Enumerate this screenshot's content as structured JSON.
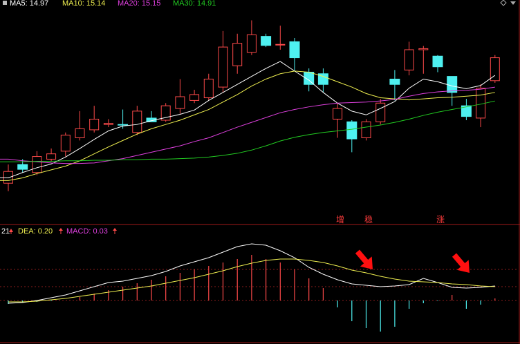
{
  "colors": {
    "up": "#ff4a4a",
    "down": "#4ef0f0",
    "ma5": "#ffffff",
    "ma10": "#f0f050",
    "ma20": "#e040e0",
    "ma30": "#22cc22",
    "dif": "#ffffff",
    "dea": "#f0f050",
    "macd_label": "#e040e0",
    "grid": "#8a1c1c",
    "arrow": "#ff1010",
    "label_text": "#ff3c3c"
  },
  "legend": {
    "ma5": "MA5: 14.97",
    "ma10": "MA10: 15.14",
    "ma20": "MA20: 15.15",
    "ma30": "MA30: 14.91"
  },
  "lower_header": {
    "dif_fragment": "21",
    "dea": "DEA: 0.20",
    "macd": "MACD: 0.03"
  },
  "annotations": [
    "增",
    "稳",
    "涨"
  ],
  "icons": [
    "arrow-up-icon",
    "diamond-icon",
    "arrow-down-icon"
  ],
  "chart_data": [
    {
      "type": "candlestick",
      "title": "",
      "series": [
        {
          "name": "K",
          "values": [
            {
              "o": 14.0,
              "h": 14.35,
              "l": 13.85,
              "c": 14.22
            },
            {
              "o": 14.35,
              "h": 14.45,
              "l": 14.2,
              "c": 14.26
            },
            {
              "o": 14.2,
              "h": 14.6,
              "l": 14.15,
              "c": 14.5
            },
            {
              "o": 14.45,
              "h": 14.65,
              "l": 14.4,
              "c": 14.55
            },
            {
              "o": 14.6,
              "h": 14.95,
              "l": 14.5,
              "c": 14.9
            },
            {
              "o": 14.85,
              "h": 15.35,
              "l": 14.8,
              "c": 15.02
            },
            {
              "o": 15.0,
              "h": 15.45,
              "l": 14.95,
              "c": 15.2
            },
            {
              "o": 15.1,
              "h": 15.2,
              "l": 15.05,
              "c": 15.12
            },
            {
              "o": 15.1,
              "h": 15.38,
              "l": 15.02,
              "c": 15.09
            },
            {
              "o": 14.95,
              "h": 15.45,
              "l": 14.9,
              "c": 15.35
            },
            {
              "o": 15.22,
              "h": 15.35,
              "l": 15.15,
              "c": 15.15
            },
            {
              "o": 15.18,
              "h": 15.5,
              "l": 15.15,
              "c": 15.45
            },
            {
              "o": 15.4,
              "h": 15.95,
              "l": 15.3,
              "c": 15.62
            },
            {
              "o": 15.55,
              "h": 15.75,
              "l": 15.5,
              "c": 15.66
            },
            {
              "o": 15.6,
              "h": 16.05,
              "l": 15.55,
              "c": 15.95
            },
            {
              "o": 15.8,
              "h": 16.85,
              "l": 15.7,
              "c": 16.55
            },
            {
              "o": 16.2,
              "h": 16.8,
              "l": 16.05,
              "c": 16.62
            },
            {
              "o": 16.45,
              "h": 17.05,
              "l": 16.4,
              "c": 16.78
            },
            {
              "o": 16.75,
              "h": 16.8,
              "l": 16.55,
              "c": 16.58
            },
            {
              "o": 16.6,
              "h": 16.95,
              "l": 16.5,
              "c": 16.6
            },
            {
              "o": 16.65,
              "h": 16.72,
              "l": 16.1,
              "c": 16.35
            },
            {
              "o": 16.08,
              "h": 16.15,
              "l": 15.72,
              "c": 15.85
            },
            {
              "o": 16.05,
              "h": 16.15,
              "l": 15.7,
              "c": 15.85
            },
            {
              "o": 15.2,
              "h": 15.5,
              "l": 14.85,
              "c": 15.4
            },
            {
              "o": 15.15,
              "h": 15.18,
              "l": 14.58,
              "c": 14.83
            },
            {
              "o": 14.85,
              "h": 15.2,
              "l": 14.8,
              "c": 15.15
            },
            {
              "o": 15.15,
              "h": 15.58,
              "l": 15.1,
              "c": 15.5
            },
            {
              "o": 15.95,
              "h": 16.12,
              "l": 15.55,
              "c": 15.85
            },
            {
              "o": 16.12,
              "h": 16.65,
              "l": 16.02,
              "c": 16.5
            },
            {
              "o": 16.5,
              "h": 16.57,
              "l": 16.05,
              "c": 16.52
            },
            {
              "o": 16.38,
              "h": 16.4,
              "l": 16.08,
              "c": 16.18
            },
            {
              "o": 16.0,
              "h": 16.0,
              "l": 15.45,
              "c": 15.7
            },
            {
              "o": 15.45,
              "h": 15.58,
              "l": 15.18,
              "c": 15.25
            },
            {
              "o": 15.22,
              "h": 15.85,
              "l": 15.05,
              "c": 15.78
            },
            {
              "o": 15.92,
              "h": 16.4,
              "l": 15.88,
              "c": 16.35
            }
          ]
        }
      ],
      "moving_averages": [
        {
          "name": "MA5",
          "values": [
            14.1,
            14.2,
            14.29,
            14.36,
            14.49,
            14.65,
            14.82,
            14.98,
            15.07,
            15.1,
            15.17,
            15.23,
            15.29,
            15.37,
            15.55,
            15.7,
            15.85,
            16.0,
            16.15,
            16.28,
            16.1,
            15.93,
            15.7,
            15.5,
            15.35,
            15.28,
            15.4,
            15.53,
            15.78,
            15.95,
            15.9,
            15.82,
            15.77,
            15.83,
            16.02
          ]
        },
        {
          "name": "MA10",
          "values": [
            14.05,
            14.1,
            14.18,
            14.25,
            14.32,
            14.42,
            14.55,
            14.68,
            14.8,
            14.92,
            15.02,
            15.1,
            15.18,
            15.28,
            15.38,
            15.52,
            15.66,
            15.82,
            15.95,
            16.05,
            16.1,
            16.08,
            16.0,
            15.9,
            15.8,
            15.68,
            15.6,
            15.58,
            15.56,
            15.58,
            15.6,
            15.61,
            15.63,
            15.65,
            15.7
          ]
        },
        {
          "name": "MA20",
          "values": [
            14.45,
            14.42,
            14.4,
            14.38,
            14.37,
            14.37,
            14.38,
            14.42,
            14.46,
            14.52,
            14.58,
            14.64,
            14.7,
            14.78,
            14.85,
            14.95,
            15.05,
            15.14,
            15.23,
            15.32,
            15.38,
            15.43,
            15.47,
            15.5,
            15.51,
            15.52,
            15.54,
            15.57,
            15.63,
            15.68,
            15.71,
            15.73,
            15.74,
            15.76,
            15.8
          ]
        },
        {
          "name": "MA30",
          "values": [
            14.4,
            14.4,
            14.41,
            14.41,
            14.42,
            14.42,
            14.43,
            14.43,
            14.44,
            14.44,
            14.45,
            14.45,
            14.46,
            14.47,
            14.49,
            14.52,
            14.56,
            14.62,
            14.7,
            14.79,
            14.86,
            14.91,
            14.95,
            14.98,
            15.01,
            15.05,
            15.09,
            15.14,
            15.2,
            15.27,
            15.33,
            15.38,
            15.43,
            15.48,
            15.54
          ]
        }
      ]
    },
    {
      "type": "bar",
      "title": "",
      "series": [
        {
          "name": "MACD",
          "values": [
            -0.05,
            -0.03,
            -0.02,
            -0.01,
            0.0,
            0.05,
            0.1,
            0.15,
            0.2,
            0.25,
            0.3,
            0.35,
            0.4,
            0.45,
            0.5,
            0.55,
            0.6,
            0.66,
            0.6,
            0.55,
            0.45,
            0.32,
            0.18,
            -0.1,
            -0.3,
            -0.4,
            -0.45,
            -0.38,
            -0.12,
            -0.04,
            -0.01,
            0.08,
            -0.12,
            -0.06,
            0.03
          ]
        },
        {
          "name": "DIF",
          "values": [
            -0.04,
            -0.03,
            0.0,
            0.04,
            0.08,
            0.14,
            0.2,
            0.26,
            0.28,
            0.32,
            0.36,
            0.42,
            0.5,
            0.56,
            0.62,
            0.7,
            0.78,
            0.82,
            0.8,
            0.72,
            0.62,
            0.48,
            0.38,
            0.3,
            0.24,
            0.22,
            0.2,
            0.21,
            0.23,
            0.32,
            0.26,
            0.19,
            0.18,
            0.19,
            0.21
          ]
        },
        {
          "name": "DEA",
          "values": [
            -0.02,
            -0.02,
            -0.01,
            0.01,
            0.03,
            0.06,
            0.09,
            0.12,
            0.15,
            0.18,
            0.21,
            0.25,
            0.29,
            0.33,
            0.38,
            0.43,
            0.49,
            0.54,
            0.58,
            0.6,
            0.6,
            0.58,
            0.55,
            0.5,
            0.44,
            0.4,
            0.35,
            0.31,
            0.28,
            0.27,
            0.26,
            0.24,
            0.23,
            0.21,
            0.2
          ]
        }
      ]
    }
  ]
}
